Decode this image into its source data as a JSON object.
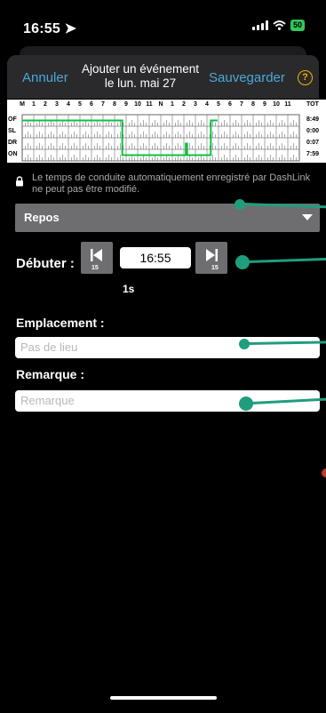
{
  "status_bar": {
    "time": "16:55",
    "battery": "50"
  },
  "header": {
    "cancel_label": "Annuler",
    "title_line1": "Ajouter un événement",
    "title_line2": "le lun. mai 27",
    "save_label": "Sauvegarder",
    "help_glyph": "?"
  },
  "graph": {
    "hours": [
      "M",
      "1",
      "2",
      "3",
      "4",
      "5",
      "6",
      "7",
      "8",
      "9",
      "10",
      "11",
      "N",
      "1",
      "2",
      "3",
      "4",
      "5",
      "6",
      "7",
      "8",
      "9",
      "10",
      "11"
    ],
    "total_header": "TOT",
    "rows": [
      {
        "label": "OF",
        "total": "8:49"
      },
      {
        "label": "SL",
        "total": "0:00"
      },
      {
        "label": "DR",
        "total": "0:07"
      },
      {
        "label": "ON",
        "total": "7:59"
      }
    ],
    "line_color": "#10c040",
    "segments": [
      {
        "status": "OF",
        "start": "0:00",
        "end": "8:40"
      },
      {
        "status": "ON",
        "start": "8:40",
        "end": "14:10"
      },
      {
        "status": "DR",
        "start": "14:10",
        "end": "14:17"
      },
      {
        "status": "ON",
        "start": "14:17",
        "end": "16:20"
      },
      {
        "status": "OF",
        "start": "16:20",
        "end": "16:55"
      }
    ]
  },
  "notice": {
    "text": "Le temps de conduite automatiquement enregistré par DashLink ne peut pas être modifié."
  },
  "status_select": {
    "value": "Repos"
  },
  "start": {
    "label": "Débuter :",
    "time": "16:55",
    "step_back": "15",
    "step_forward": "15",
    "interval": "1s"
  },
  "location": {
    "label": "Emplacement :",
    "placeholder": "Pas de lieu"
  },
  "remark": {
    "label": "Remarque :",
    "placeholder": "Remarque"
  },
  "colors": {
    "accent": "#4aa8d8",
    "help": "#f0b400",
    "pointer": "#1f9e7e",
    "battery": "#34c759"
  }
}
